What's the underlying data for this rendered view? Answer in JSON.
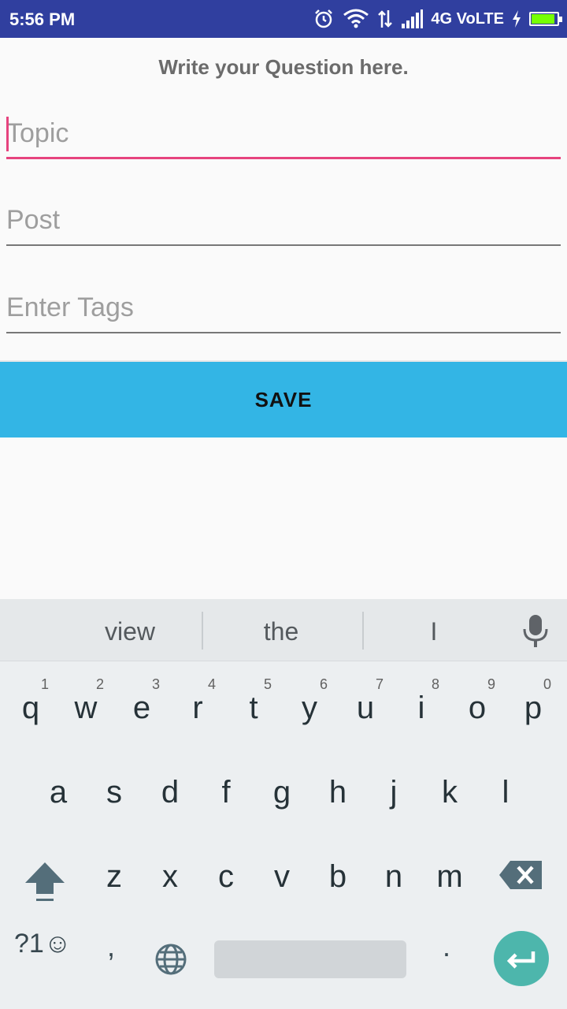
{
  "status_bar": {
    "time": "5:56 PM",
    "network": "4G VoLTE",
    "battery_level": 0.9
  },
  "header": {
    "title": "Write your Question here."
  },
  "form": {
    "topic_placeholder": "Topic",
    "post_placeholder": "Post",
    "tags_placeholder": "Enter Tags",
    "save_label": "SAVE"
  },
  "keyboard": {
    "suggestions": [
      "view",
      "the",
      "I"
    ],
    "row1": [
      "q",
      "w",
      "e",
      "r",
      "t",
      "y",
      "u",
      "i",
      "o",
      "p"
    ],
    "row1_hints": [
      "1",
      "2",
      "3",
      "4",
      "5",
      "6",
      "7",
      "8",
      "9",
      "0"
    ],
    "row2": [
      "a",
      "s",
      "d",
      "f",
      "g",
      "h",
      "j",
      "k",
      "l"
    ],
    "row3": [
      "z",
      "x",
      "c",
      "v",
      "b",
      "n",
      "m"
    ],
    "symbols_label": "?1☺",
    "comma": ",",
    "period": ".",
    "accent_color": "#4DB6AC"
  }
}
